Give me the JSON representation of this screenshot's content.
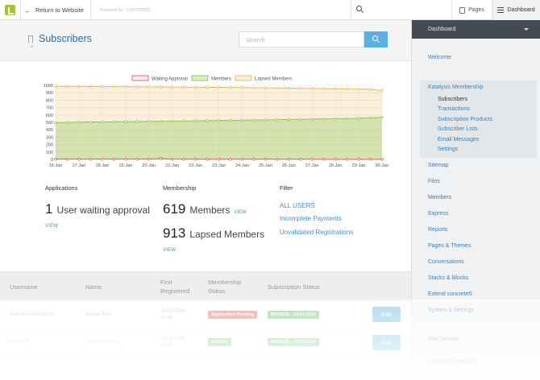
{
  "toolbar": {
    "return_label": "Return to Website",
    "powered_by": "Powered by",
    "brand": "concrete5",
    "pages_label": "Pages",
    "dashboard_label": "Dashboard"
  },
  "header": {
    "title": "Subscribers",
    "search_placeholder": "Search"
  },
  "chart_data": {
    "type": "line",
    "legend": [
      "Waiting Approval",
      "Members",
      "Lapsed Members"
    ],
    "legend_position": "top-center",
    "colors": {
      "Waiting Approval": "#d94b4b",
      "Members": "#7fc248",
      "Lapsed Members": "#e9b04f"
    },
    "categories": [
      "16-Jan",
      "17-Jan",
      "18-Jan",
      "19-Jan",
      "20-Jan",
      "21-Jan",
      "22-Jan",
      "23-Jan",
      "24-Jan",
      "25-Jan",
      "26-Jan",
      "27-Jan",
      "28-Jan",
      "29-Jan",
      "30-Jan"
    ],
    "ylim": [
      0,
      1000
    ],
    "yticks": [
      0,
      100,
      200,
      300,
      400,
      500,
      600,
      700,
      800,
      900,
      1000
    ],
    "grid": true,
    "series": [
      {
        "name": "Waiting Approval",
        "values": [
          3,
          3,
          3,
          3,
          3,
          3,
          3,
          3,
          3,
          12,
          3,
          2,
          2,
          2,
          2,
          2,
          2,
          2,
          2,
          2,
          2,
          2,
          2,
          1,
          1,
          1,
          1,
          1,
          1
        ]
      },
      {
        "name": "Members",
        "values": [
          495,
          499,
          502,
          505,
          507,
          509,
          510,
          511,
          513,
          515,
          517,
          519,
          521,
          523,
          525,
          527,
          529,
          531,
          534,
          536,
          539,
          541,
          544,
          547,
          550,
          552,
          555,
          560,
          570
        ]
      },
      {
        "name": "Lapsed Members",
        "values": [
          987,
          986,
          985,
          984,
          983,
          982,
          981,
          980,
          979,
          978,
          977,
          976,
          975,
          974,
          973,
          972,
          970,
          968,
          966,
          964,
          962,
          960,
          958,
          956,
          953,
          950,
          948,
          946,
          930
        ]
      }
    ]
  },
  "stats": {
    "applications_label": "Applications",
    "waiting_count": "1",
    "waiting_text": "User waiting approval",
    "applications_view": "VIEW",
    "membership_label": "Membership",
    "members_count": "619",
    "members_text": "Members",
    "members_view": "VIEW",
    "lapsed_count": "913",
    "lapsed_text": "Lapsed Members",
    "lapsed_view": "VIEW",
    "filter_label": "Filter",
    "filters": [
      "ALL USERS",
      "Incomplete Payments",
      "Unvalidated Registrations"
    ]
  },
  "table": {
    "headers": {
      "username": "Username",
      "name": "Name",
      "first_registered": "First Registered",
      "membership_status": "Membership Status",
      "subscription_status": "Subscription Status"
    },
    "rows": [
      {
        "username": "Baskar.biotech31132",
        "name": "Baskar Raju",
        "date": "30/01/2018, 10:29",
        "membership": "Application Pending",
        "membership_color": "red",
        "subscription": "BRONZE - 01/01/2019",
        "edit": "Edit"
      },
      {
        "username": "MM2026",
        "name": "Juergen Portes",
        "date": "29/01/2018, 10:28",
        "membership": "Member",
        "membership_color": "green",
        "subscription": "BRONZE - 01/01/2019",
        "edit": "Edit"
      },
      {
        "username": "",
        "name": "",
        "date": "",
        "membership": "",
        "membership_color": "green",
        "subscription": "",
        "edit": ""
      }
    ]
  },
  "sidebar": {
    "select_label": "Dashboard",
    "welcome": "Welcome",
    "group_title": "Katalysis Membership",
    "group_items": [
      "Subscribers",
      "Transactions",
      "Subscription Products",
      "Subscriber Lists",
      "Email Messages",
      "Settings"
    ],
    "items": [
      "Sitemap",
      "Files",
      "Members",
      "Express",
      "Reports",
      "Pages & Themes",
      "Conversations",
      "Stacks & Blocks",
      "Extend concrete5",
      "System & Settings"
    ],
    "footer_items": [
      "Mail Service",
      "Upload to Katalysis"
    ]
  }
}
